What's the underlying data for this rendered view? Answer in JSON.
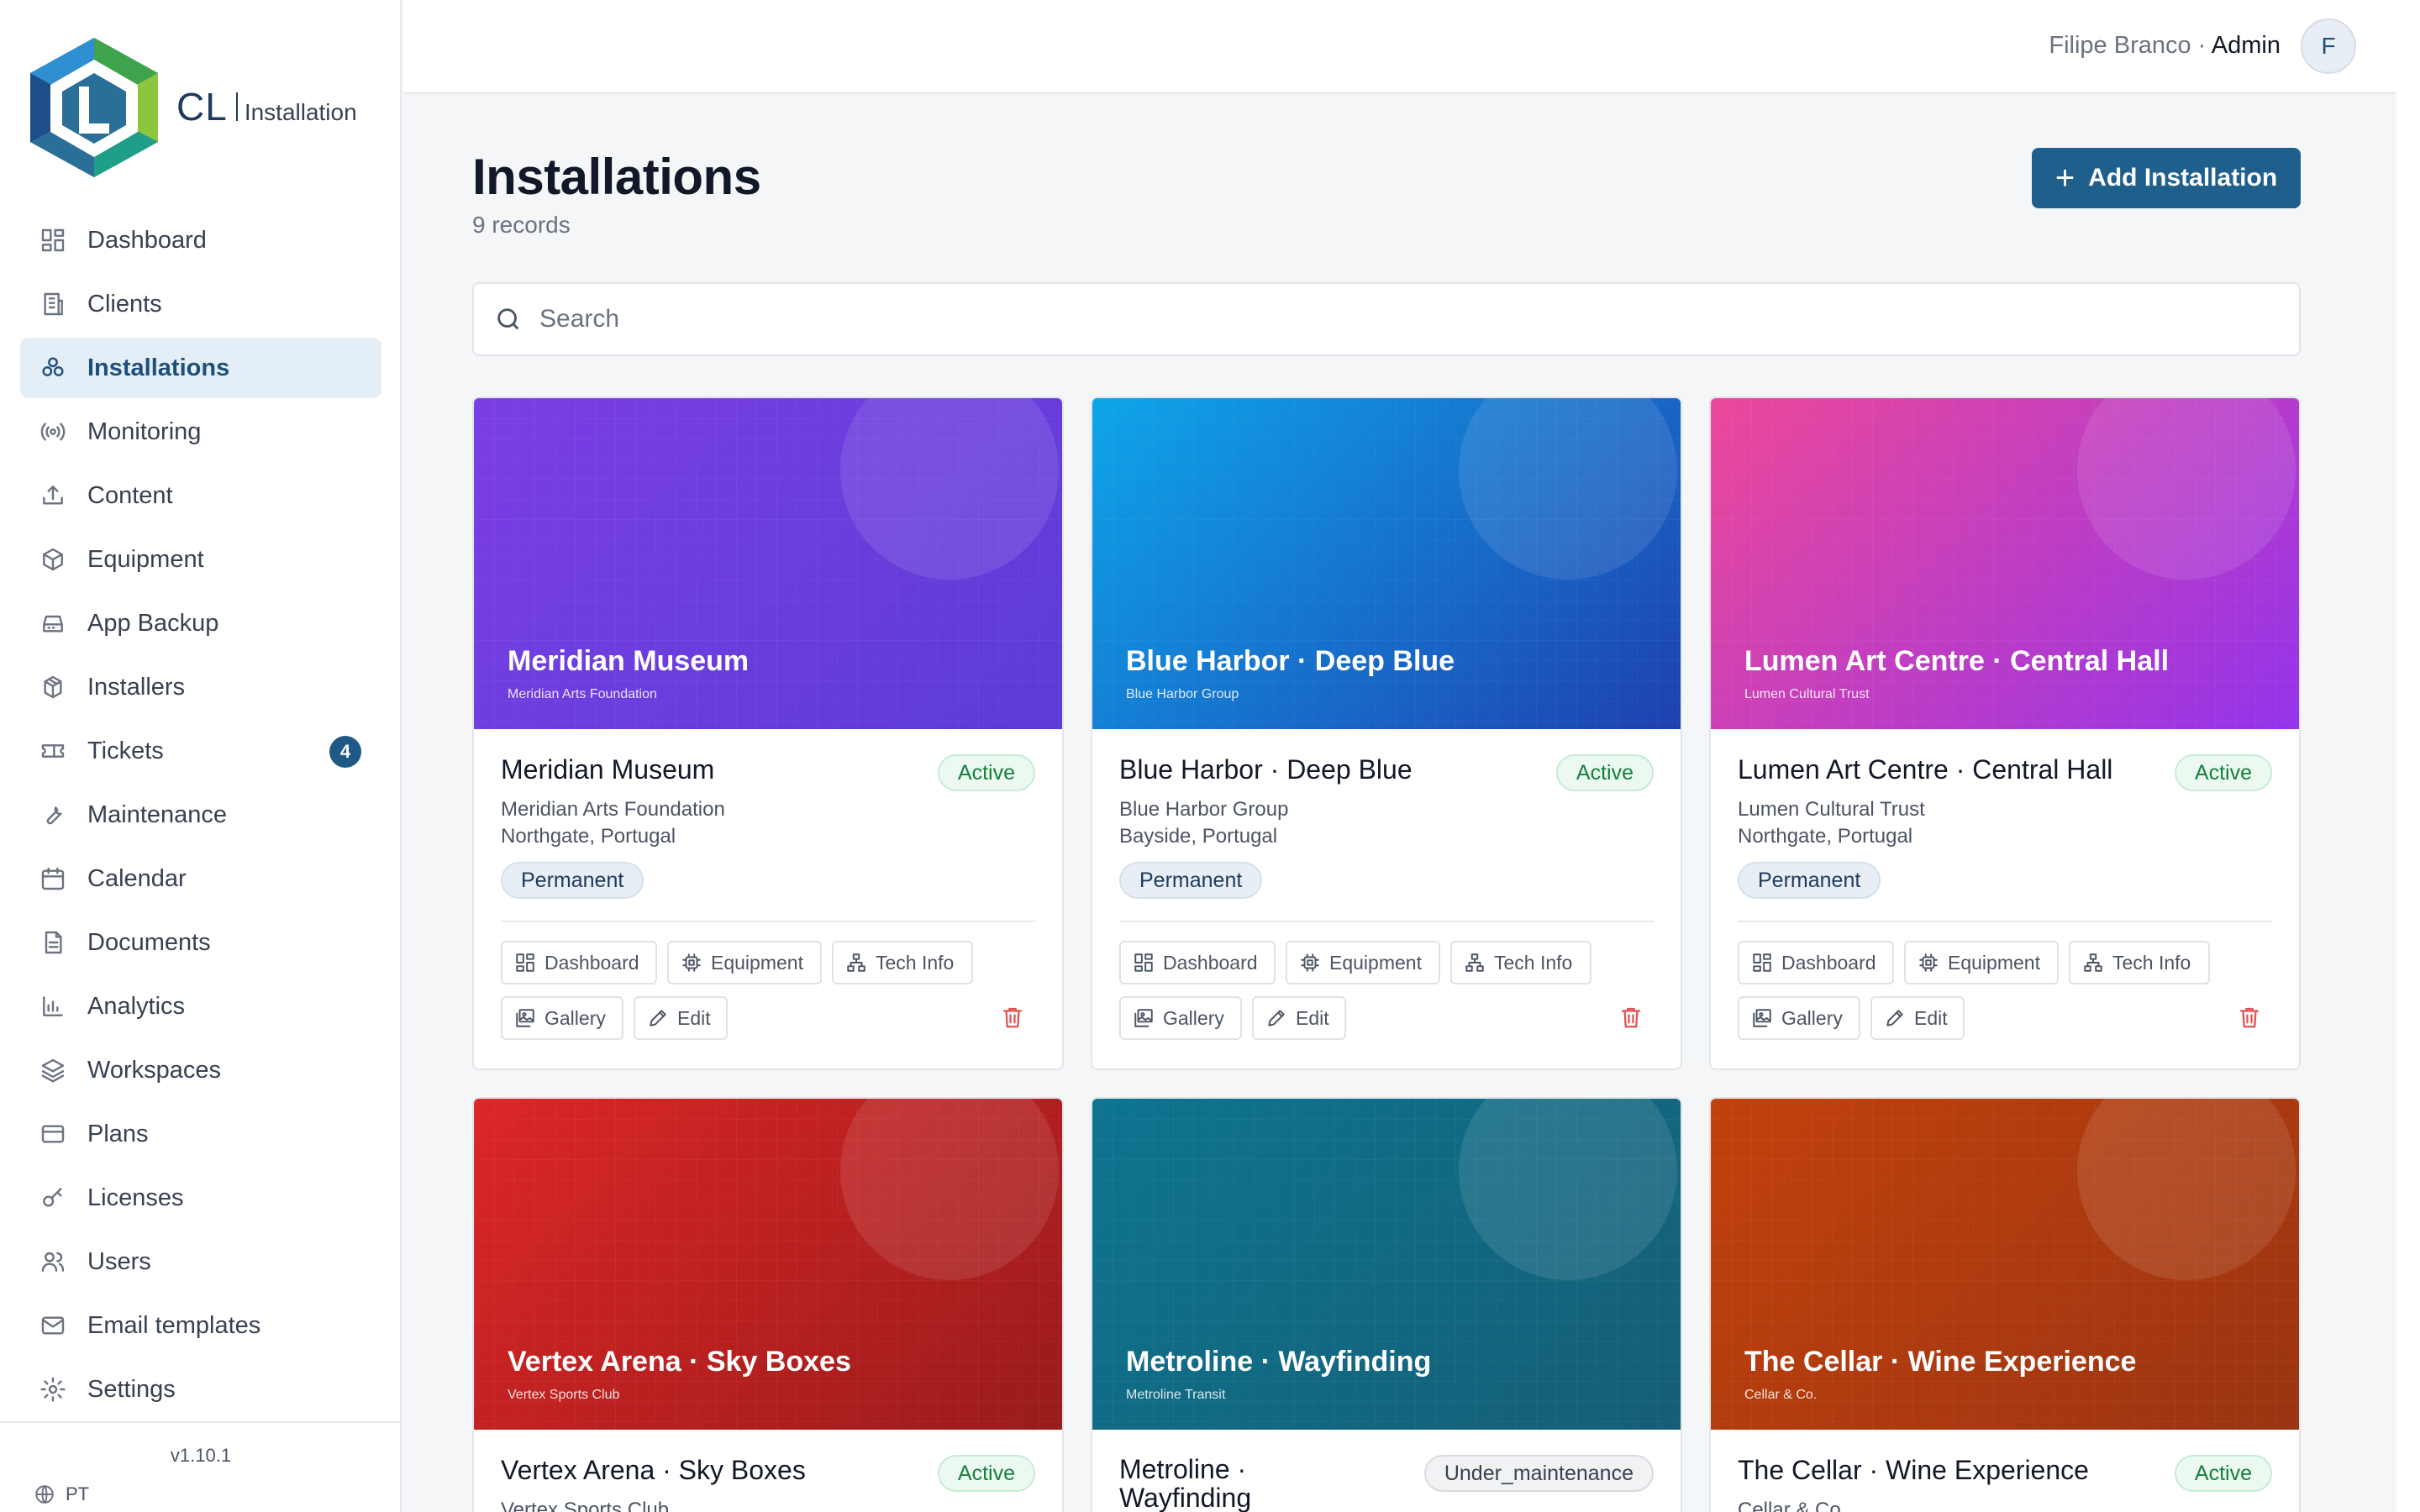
{
  "brand": {
    "short": "CL",
    "product": "Installation"
  },
  "sidebar": {
    "items": [
      {
        "label": "Dashboard",
        "icon": "dashboard-icon"
      },
      {
        "label": "Clients",
        "icon": "building-icon"
      },
      {
        "label": "Installations",
        "icon": "installations-icon",
        "active": true
      },
      {
        "label": "Monitoring",
        "icon": "radio-icon"
      },
      {
        "label": "Content",
        "icon": "upload-icon"
      },
      {
        "label": "Equipment",
        "icon": "box-icon"
      },
      {
        "label": "App Backup",
        "icon": "drive-icon"
      },
      {
        "label": "Installers",
        "icon": "boxes-icon"
      },
      {
        "label": "Tickets",
        "icon": "ticket-icon",
        "badge": "4"
      },
      {
        "label": "Maintenance",
        "icon": "wrench-icon"
      },
      {
        "label": "Calendar",
        "icon": "calendar-icon"
      },
      {
        "label": "Documents",
        "icon": "document-icon"
      },
      {
        "label": "Analytics",
        "icon": "analytics-icon"
      },
      {
        "label": "Workspaces",
        "icon": "layers-icon"
      },
      {
        "label": "Plans",
        "icon": "card-icon"
      },
      {
        "label": "Licenses",
        "icon": "key-icon"
      },
      {
        "label": "Users",
        "icon": "users-icon"
      },
      {
        "label": "Email templates",
        "icon": "mail-icon"
      },
      {
        "label": "Settings",
        "icon": "gear-icon"
      }
    ],
    "version": "v1.10.1",
    "language": "PT"
  },
  "topbar": {
    "user_name": "Filipe Branco",
    "separator": " · ",
    "role": "Admin",
    "avatar_initial": "F"
  },
  "page": {
    "title": "Installations",
    "count": "9 records",
    "add_label": "Add Installation"
  },
  "search": {
    "placeholder": "Search"
  },
  "actions": {
    "dashboard": "Dashboard",
    "equipment": "Equipment",
    "tech_info": "Tech Info",
    "gallery": "Gallery",
    "edit": "Edit"
  },
  "cards": [
    {
      "title": "Meridian Museum",
      "org": "Meridian Arts Foundation",
      "location": "Northgate, Portugal",
      "status": "Active",
      "type": "Permanent",
      "colors": [
        "#7b3fe4",
        "#5b3bd6"
      ]
    },
    {
      "title": "Blue Harbor · Deep Blue",
      "org": "Blue Harbor Group",
      "location": "Bayside, Portugal",
      "status": "Active",
      "type": "Permanent",
      "colors": [
        "#0ea5e9",
        "#1e40af"
      ]
    },
    {
      "title": "Lumen Art Centre · Central Hall",
      "org": "Lumen Cultural Trust",
      "location": "Northgate, Portugal",
      "status": "Active",
      "type": "Permanent",
      "colors": [
        "#ec4899",
        "#9333ea"
      ]
    },
    {
      "title": "Vertex Arena · Sky Boxes",
      "org": "Vertex Sports Club",
      "location": "",
      "status": "Active",
      "type": "",
      "colors": [
        "#dc2626",
        "#991b1b"
      ]
    },
    {
      "title": "Metroline · Wayfinding",
      "title_wrapped": [
        "Metroline ·",
        "Wayfinding"
      ],
      "org": "Metroline Transit",
      "location": "",
      "status": "Under_maintenance",
      "type": "",
      "colors": [
        "#0e7490",
        "#155e75"
      ]
    },
    {
      "title": "The Cellar · Wine Experience",
      "org": "Cellar & Co.",
      "location": "",
      "status": "Active",
      "type": "",
      "colors": [
        "#c2410c",
        "#9a3412"
      ]
    }
  ]
}
